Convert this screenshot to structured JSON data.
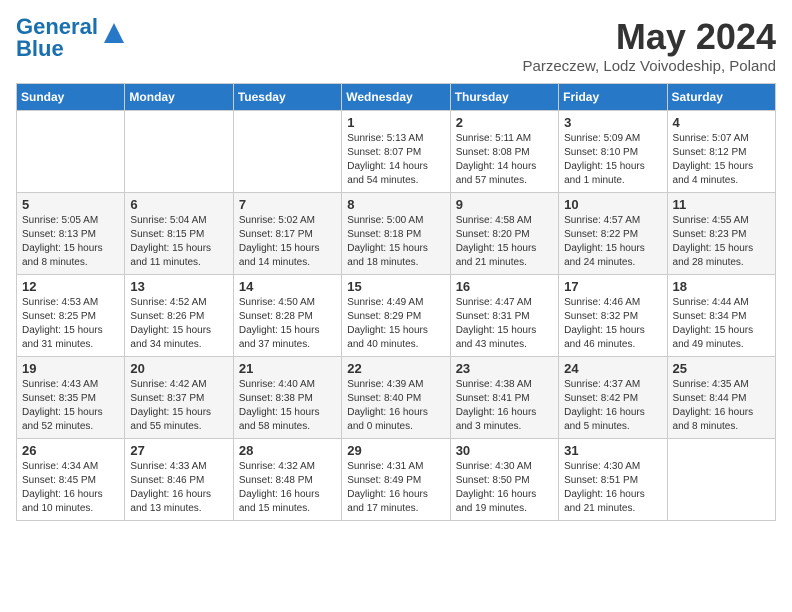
{
  "header": {
    "logo_line1": "General",
    "logo_line2": "Blue",
    "month": "May 2024",
    "location": "Parzeczew, Lodz Voivodeship, Poland"
  },
  "days_of_week": [
    "Sunday",
    "Monday",
    "Tuesday",
    "Wednesday",
    "Thursday",
    "Friday",
    "Saturday"
  ],
  "weeks": [
    [
      {
        "day": "",
        "sunrise": "",
        "sunset": "",
        "daylight": ""
      },
      {
        "day": "",
        "sunrise": "",
        "sunset": "",
        "daylight": ""
      },
      {
        "day": "",
        "sunrise": "",
        "sunset": "",
        "daylight": ""
      },
      {
        "day": "1",
        "sunrise": "Sunrise: 5:13 AM",
        "sunset": "Sunset: 8:07 PM",
        "daylight": "Daylight: 14 hours and 54 minutes."
      },
      {
        "day": "2",
        "sunrise": "Sunrise: 5:11 AM",
        "sunset": "Sunset: 8:08 PM",
        "daylight": "Daylight: 14 hours and 57 minutes."
      },
      {
        "day": "3",
        "sunrise": "Sunrise: 5:09 AM",
        "sunset": "Sunset: 8:10 PM",
        "daylight": "Daylight: 15 hours and 1 minute."
      },
      {
        "day": "4",
        "sunrise": "Sunrise: 5:07 AM",
        "sunset": "Sunset: 8:12 PM",
        "daylight": "Daylight: 15 hours and 4 minutes."
      }
    ],
    [
      {
        "day": "5",
        "sunrise": "Sunrise: 5:05 AM",
        "sunset": "Sunset: 8:13 PM",
        "daylight": "Daylight: 15 hours and 8 minutes."
      },
      {
        "day": "6",
        "sunrise": "Sunrise: 5:04 AM",
        "sunset": "Sunset: 8:15 PM",
        "daylight": "Daylight: 15 hours and 11 minutes."
      },
      {
        "day": "7",
        "sunrise": "Sunrise: 5:02 AM",
        "sunset": "Sunset: 8:17 PM",
        "daylight": "Daylight: 15 hours and 14 minutes."
      },
      {
        "day": "8",
        "sunrise": "Sunrise: 5:00 AM",
        "sunset": "Sunset: 8:18 PM",
        "daylight": "Daylight: 15 hours and 18 minutes."
      },
      {
        "day": "9",
        "sunrise": "Sunrise: 4:58 AM",
        "sunset": "Sunset: 8:20 PM",
        "daylight": "Daylight: 15 hours and 21 minutes."
      },
      {
        "day": "10",
        "sunrise": "Sunrise: 4:57 AM",
        "sunset": "Sunset: 8:22 PM",
        "daylight": "Daylight: 15 hours and 24 minutes."
      },
      {
        "day": "11",
        "sunrise": "Sunrise: 4:55 AM",
        "sunset": "Sunset: 8:23 PM",
        "daylight": "Daylight: 15 hours and 28 minutes."
      }
    ],
    [
      {
        "day": "12",
        "sunrise": "Sunrise: 4:53 AM",
        "sunset": "Sunset: 8:25 PM",
        "daylight": "Daylight: 15 hours and 31 minutes."
      },
      {
        "day": "13",
        "sunrise": "Sunrise: 4:52 AM",
        "sunset": "Sunset: 8:26 PM",
        "daylight": "Daylight: 15 hours and 34 minutes."
      },
      {
        "day": "14",
        "sunrise": "Sunrise: 4:50 AM",
        "sunset": "Sunset: 8:28 PM",
        "daylight": "Daylight: 15 hours and 37 minutes."
      },
      {
        "day": "15",
        "sunrise": "Sunrise: 4:49 AM",
        "sunset": "Sunset: 8:29 PM",
        "daylight": "Daylight: 15 hours and 40 minutes."
      },
      {
        "day": "16",
        "sunrise": "Sunrise: 4:47 AM",
        "sunset": "Sunset: 8:31 PM",
        "daylight": "Daylight: 15 hours and 43 minutes."
      },
      {
        "day": "17",
        "sunrise": "Sunrise: 4:46 AM",
        "sunset": "Sunset: 8:32 PM",
        "daylight": "Daylight: 15 hours and 46 minutes."
      },
      {
        "day": "18",
        "sunrise": "Sunrise: 4:44 AM",
        "sunset": "Sunset: 8:34 PM",
        "daylight": "Daylight: 15 hours and 49 minutes."
      }
    ],
    [
      {
        "day": "19",
        "sunrise": "Sunrise: 4:43 AM",
        "sunset": "Sunset: 8:35 PM",
        "daylight": "Daylight: 15 hours and 52 minutes."
      },
      {
        "day": "20",
        "sunrise": "Sunrise: 4:42 AM",
        "sunset": "Sunset: 8:37 PM",
        "daylight": "Daylight: 15 hours and 55 minutes."
      },
      {
        "day": "21",
        "sunrise": "Sunrise: 4:40 AM",
        "sunset": "Sunset: 8:38 PM",
        "daylight": "Daylight: 15 hours and 58 minutes."
      },
      {
        "day": "22",
        "sunrise": "Sunrise: 4:39 AM",
        "sunset": "Sunset: 8:40 PM",
        "daylight": "Daylight: 16 hours and 0 minutes."
      },
      {
        "day": "23",
        "sunrise": "Sunrise: 4:38 AM",
        "sunset": "Sunset: 8:41 PM",
        "daylight": "Daylight: 16 hours and 3 minutes."
      },
      {
        "day": "24",
        "sunrise": "Sunrise: 4:37 AM",
        "sunset": "Sunset: 8:42 PM",
        "daylight": "Daylight: 16 hours and 5 minutes."
      },
      {
        "day": "25",
        "sunrise": "Sunrise: 4:35 AM",
        "sunset": "Sunset: 8:44 PM",
        "daylight": "Daylight: 16 hours and 8 minutes."
      }
    ],
    [
      {
        "day": "26",
        "sunrise": "Sunrise: 4:34 AM",
        "sunset": "Sunset: 8:45 PM",
        "daylight": "Daylight: 16 hours and 10 minutes."
      },
      {
        "day": "27",
        "sunrise": "Sunrise: 4:33 AM",
        "sunset": "Sunset: 8:46 PM",
        "daylight": "Daylight: 16 hours and 13 minutes."
      },
      {
        "day": "28",
        "sunrise": "Sunrise: 4:32 AM",
        "sunset": "Sunset: 8:48 PM",
        "daylight": "Daylight: 16 hours and 15 minutes."
      },
      {
        "day": "29",
        "sunrise": "Sunrise: 4:31 AM",
        "sunset": "Sunset: 8:49 PM",
        "daylight": "Daylight: 16 hours and 17 minutes."
      },
      {
        "day": "30",
        "sunrise": "Sunrise: 4:30 AM",
        "sunset": "Sunset: 8:50 PM",
        "daylight": "Daylight: 16 hours and 19 minutes."
      },
      {
        "day": "31",
        "sunrise": "Sunrise: 4:30 AM",
        "sunset": "Sunset: 8:51 PM",
        "daylight": "Daylight: 16 hours and 21 minutes."
      },
      {
        "day": "",
        "sunrise": "",
        "sunset": "",
        "daylight": ""
      }
    ]
  ]
}
